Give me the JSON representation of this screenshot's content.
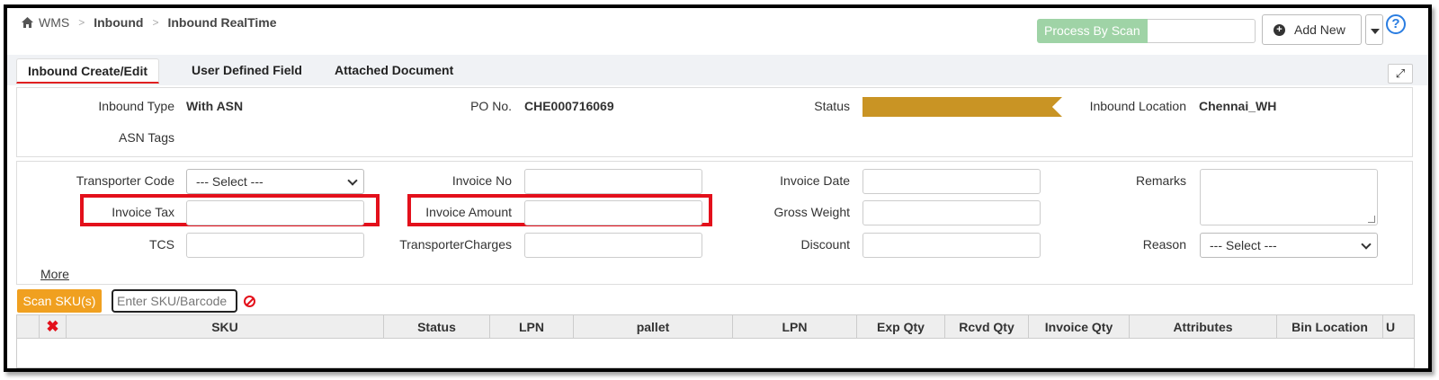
{
  "breadcrumb": {
    "home": "WMS",
    "level1": "Inbound",
    "level2": "Inbound RealTime",
    "separator": ">"
  },
  "header": {
    "process_by_scan": "Process By Scan",
    "add_new": "Add New",
    "help": "?"
  },
  "tabs": [
    {
      "label": "Inbound Create/Edit",
      "active": true
    },
    {
      "label": "User Defined Field",
      "active": false
    },
    {
      "label": "Attached Document",
      "active": false
    }
  ],
  "summary": {
    "inbound_type_label": "Inbound Type",
    "inbound_type_value": "With ASN",
    "po_label": "PO No.",
    "po_value": "CHE000716069",
    "status_label": "Status",
    "status_color": "#c99424",
    "location_label": "Inbound Location",
    "location_value": "Chennai_WH",
    "asn_tags_label": "ASN Tags"
  },
  "form": {
    "transporter_code_label": "Transporter Code",
    "transporter_code_value": "--- Select ---",
    "invoice_no_label": "Invoice No",
    "invoice_date_label": "Invoice Date",
    "remarks_label": "Remarks",
    "invoice_tax_label": "Invoice Tax",
    "invoice_amount_label": "Invoice Amount",
    "gross_weight_label": "Gross Weight",
    "tcs_label": "TCS",
    "transporter_charges_label": "TransporterCharges",
    "discount_label": "Discount",
    "reason_label": "Reason",
    "reason_value": "--- Select ---",
    "more_link": "More",
    "highlight_color": "#e3101b"
  },
  "scan": {
    "button": "Scan SKU(s)",
    "placeholder": "Enter SKU/Barcode"
  },
  "table": {
    "columns": [
      "SKU",
      "Status",
      "LPN",
      "pallet",
      "LPN",
      "Exp Qty",
      "Rcvd Qty",
      "Invoice Qty",
      "Attributes",
      "Bin Location",
      "U"
    ]
  }
}
